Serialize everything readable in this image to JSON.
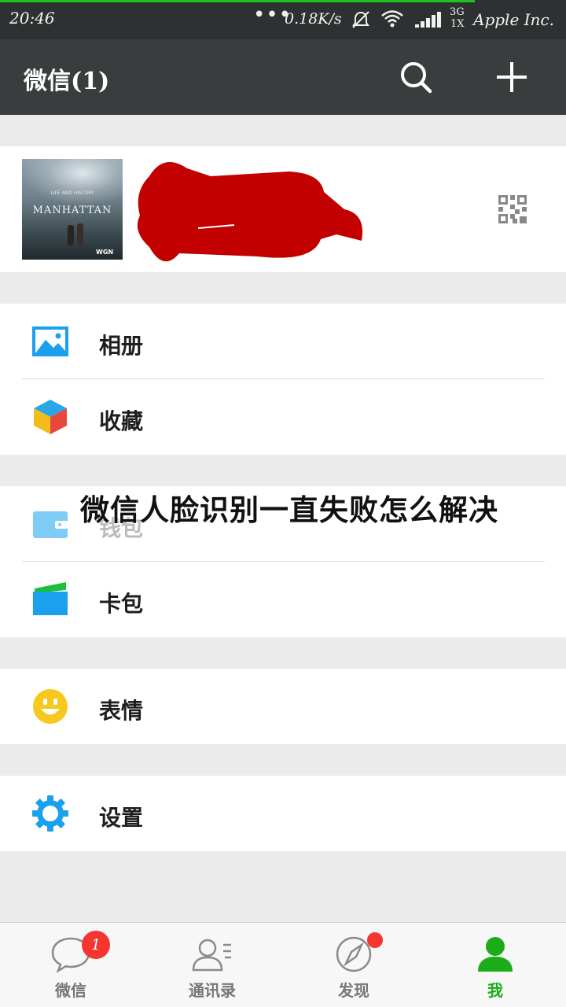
{
  "status_bar": {
    "time": "20:46",
    "dots": "•••",
    "network_speed": "0.18K/s",
    "signal_type_top": "3G",
    "signal_type_bottom": "1X",
    "carrier": "Apple Inc.",
    "progress_color": "#23c123"
  },
  "header": {
    "title": "微信(1)",
    "icons": [
      "search-icon",
      "plus-icon"
    ]
  },
  "profile": {
    "avatar_poster_small": "MANHATTAN",
    "avatar_poster_top": "LIFE AND HISTORY",
    "avatar_poster_bottom": "WGN",
    "redaction_color": "#c00000",
    "qr_icon": "qr-code-icon"
  },
  "menu_groups": [
    {
      "items": [
        {
          "label": "相册",
          "icon": "album-icon"
        },
        {
          "label": "收藏",
          "icon": "favorites-cube-icon"
        }
      ]
    },
    {
      "items": [
        {
          "label": "钱包",
          "icon": "wallet-icon"
        },
        {
          "label": "卡包",
          "icon": "card-package-icon"
        }
      ]
    },
    {
      "items": [
        {
          "label": "表情",
          "icon": "smiley-icon"
        }
      ]
    },
    {
      "items": [
        {
          "label": "设置",
          "icon": "gear-icon"
        }
      ]
    }
  ],
  "overlay_caption": "微信人脸识别一直失败怎么解决",
  "bottom_nav": {
    "tabs": [
      {
        "label": "微信",
        "icon": "chat-bubble-icon",
        "badge": "1",
        "active": false
      },
      {
        "label": "通讯录",
        "icon": "contacts-icon",
        "active": false
      },
      {
        "label": "发现",
        "icon": "compass-icon",
        "dot": true,
        "active": false
      },
      {
        "label": "我",
        "icon": "person-icon",
        "active": true
      }
    ],
    "active_color": "#1aad19"
  }
}
